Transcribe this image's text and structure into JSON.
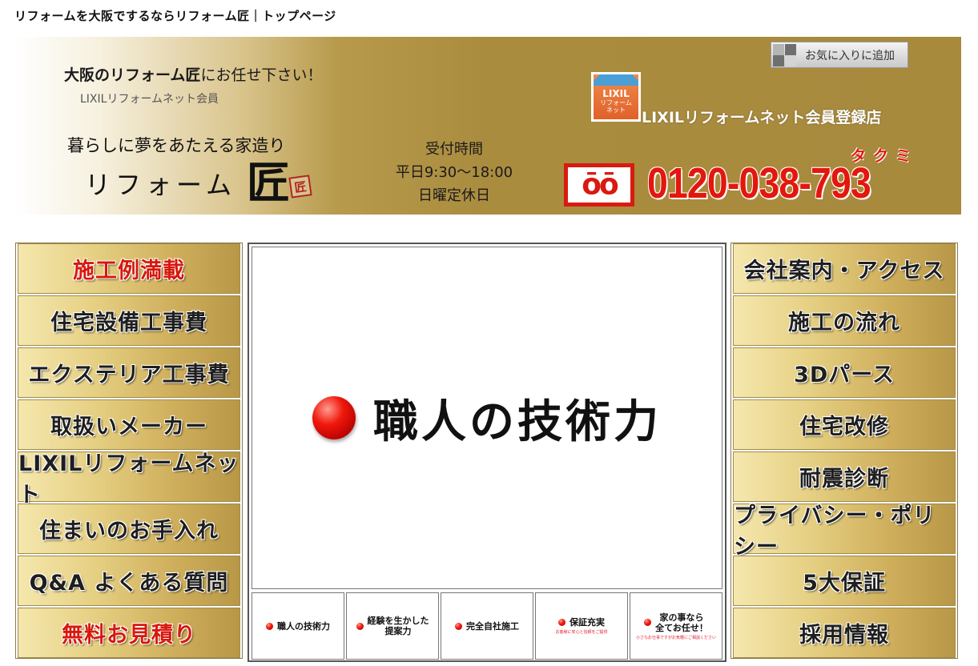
{
  "page": {
    "title": "リフォームを大阪でするならリフォーム匠｜トップページ"
  },
  "header": {
    "tagline_bold": "大阪のリフォーム匠",
    "tagline_rest": "にお任せ下さい！",
    "member_sub": "LIXILリフォームネット会員",
    "logo_catch": "暮らしに夢をあたえる家造り",
    "logo_name": "リフォーム",
    "logo_kanji": "匠",
    "logo_seal": "匠",
    "hours_title": "受付時間",
    "hours_weekday": "平日9:30〜18:00",
    "hours_closed": "日曜定休日",
    "favorite_button": "お気に入りに追加",
    "lixil_badge_brand": "LIXIL",
    "lixil_badge_sub": "リフォーム\nネット",
    "lixil_store": "LIXILリフォームネット会員登録店",
    "freedial_mark": "ōō",
    "phone": "0120-038-793",
    "phone_ruby": "タクミ"
  },
  "left_nav": [
    {
      "label": "施工例満載",
      "color": "#d8170c"
    },
    {
      "label": "住宅設備工事費"
    },
    {
      "label": "エクステリア工事費"
    },
    {
      "label": "取扱いメーカー"
    },
    {
      "label": "LIXILリフォームネット"
    },
    {
      "label": "住まいのお手入れ"
    },
    {
      "label": "Q&A よくある質問"
    },
    {
      "label": "無料お見積り",
      "color": "#d8170c"
    }
  ],
  "right_nav": [
    {
      "label": "会社案内・アクセス"
    },
    {
      "label": "施工の流れ"
    },
    {
      "label": "3Dパース"
    },
    {
      "label": "住宅改修"
    },
    {
      "label": "耐震診断"
    },
    {
      "label": "プライバシー・ポリシー"
    },
    {
      "label": "5大保証"
    },
    {
      "label": "採用情報"
    }
  ],
  "slideshow": {
    "current_heading": "職人の技術力",
    "thumbs": [
      {
        "label": "職人の技術力",
        "sub": ""
      },
      {
        "label": "経験を生かした\n提案力",
        "sub": ""
      },
      {
        "label": "完全自社施工",
        "sub": ""
      },
      {
        "label": "保証充実",
        "sub": "お客様に安心と信頼をご提供"
      },
      {
        "label": "家の事なら\n全てお任せ！",
        "sub": "小さなお仕事ですがお気軽にご相談ください"
      }
    ]
  },
  "colors": {
    "accent_red": "#e3170d",
    "banner_gold": "#a88a3d"
  }
}
